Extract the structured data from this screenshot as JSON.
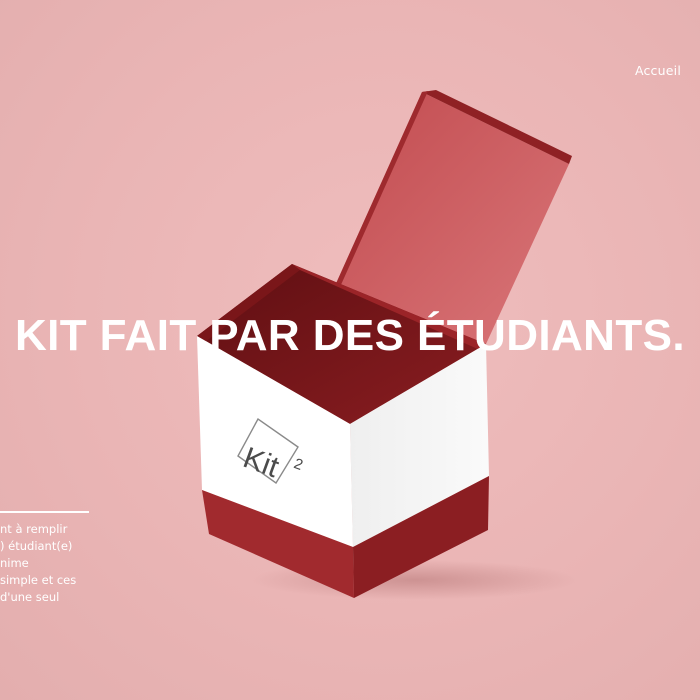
{
  "nav": {
    "home_label": "Accueil"
  },
  "hero": {
    "headline": "KIT FAIT PAR DES ÉTUDIANTS.",
    "description_lines": [
      "nt à remplir",
      ") étudiant(e)",
      "nime",
      "simple et ces",
      "d'une seul"
    ]
  },
  "product": {
    "logo_text": "Kit",
    "logo_superscript": "2"
  },
  "colors": {
    "background": "#ebb7b7",
    "box_red": "#8f2124",
    "box_white": "#ffffff",
    "text": "#ffffff"
  }
}
